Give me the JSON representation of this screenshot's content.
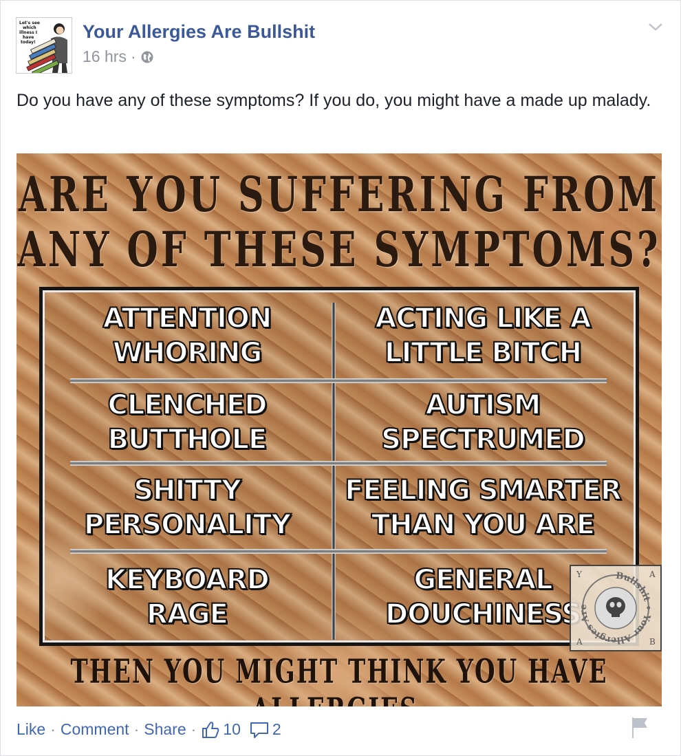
{
  "post": {
    "page_name": "Your Allergies Are Bullshit",
    "timestamp": "16 hrs",
    "separator": "·",
    "privacy_icon": "globe-icon",
    "options_icon": "chevron-down-icon",
    "text": "Do you have any of these symptoms? If you do, you might have a made up malady."
  },
  "avatar": {
    "caption_lines": [
      "Let's see",
      "which",
      "illness I",
      "have",
      "today!"
    ]
  },
  "meme": {
    "headline_line1": "ARE YOU SUFFERING FROM",
    "headline_line2": "ANY OF THESE SYMPTOMS?",
    "cells": [
      {
        "line1": "ATTENTION",
        "line2": "WHORING"
      },
      {
        "line1": "ACTING LIKE A",
        "line2": "LITTLE BITCH"
      },
      {
        "line1": "CLENCHED",
        "line2": "BUTTHOLE"
      },
      {
        "line1": "AUTISM",
        "line2": "SPECTRUMED"
      },
      {
        "line1": "SHITTY",
        "line2": "PERSONALITY"
      },
      {
        "line1": "FEELING SMARTER",
        "line2": "THAN YOU ARE"
      },
      {
        "line1": "KEYBOARD",
        "line2": "RAGE"
      },
      {
        "line1": "GENERAL",
        "line2": "DOUCHINESS"
      }
    ],
    "footer": "THEN YOU MIGHT THINK YOU HAVE ALLERGIES.",
    "watermark": {
      "corner_tl": "Y",
      "corner_tr": "A",
      "corner_bl": "A",
      "corner_br": "B",
      "ring_text": "Bullshit • Your Allergies Are"
    }
  },
  "actions": {
    "like": "Like",
    "comment": "Comment",
    "share": "Share",
    "separator": "·",
    "like_count": "10",
    "comment_count": "2",
    "like_icon": "thumbs-up-icon",
    "comment_icon": "speech-bubble-icon",
    "flag_icon": "flag-icon"
  },
  "colors": {
    "link_blue": "#3b5998",
    "action_blue": "#4267b2",
    "meta_gray": "#90949c",
    "text_dark": "#1d2129"
  }
}
